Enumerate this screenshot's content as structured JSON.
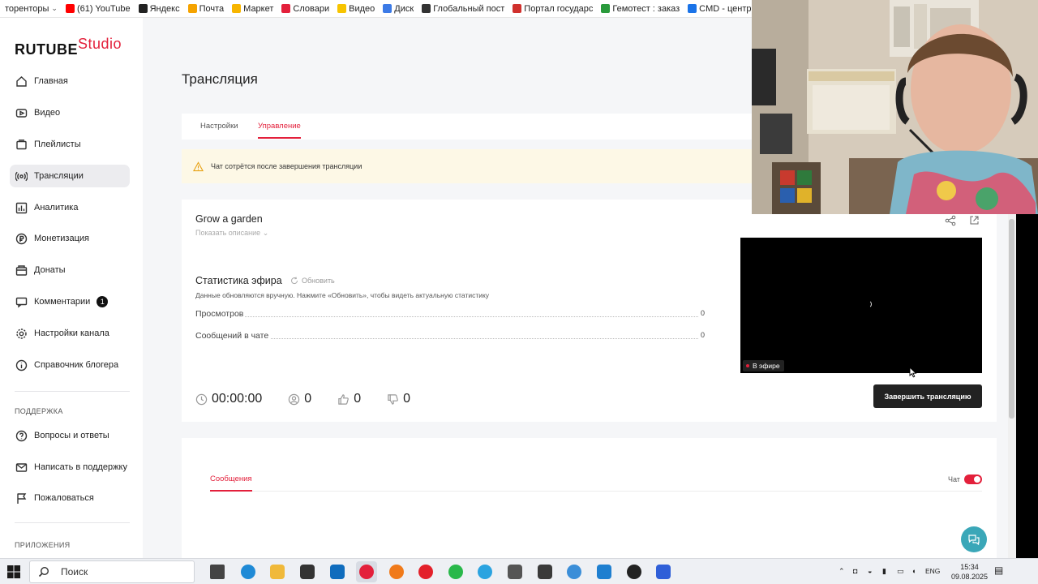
{
  "bookmarks": [
    {
      "label": "торенторы",
      "color": "#f2c200",
      "folder": true
    },
    {
      "label": "(61) YouTube",
      "color": "#ff0000"
    },
    {
      "label": "Яндекс",
      "color": "#222222"
    },
    {
      "label": "Почта",
      "color": "#f5a300"
    },
    {
      "label": "Маркет",
      "color": "#f7b500"
    },
    {
      "label": "Словари",
      "color": "#e3203b"
    },
    {
      "label": "Видео",
      "color": "#f7c400"
    },
    {
      "label": "Диск",
      "color": "#3c7ae6"
    },
    {
      "label": "Глобальный пост",
      "color": "#333333"
    },
    {
      "label": "Портал государс",
      "color": "#d0302d"
    },
    {
      "label": "Гемотест : заказ",
      "color": "#2a9a3c"
    },
    {
      "label": "CMD - центр мол",
      "color": "#1a73e8"
    }
  ],
  "logo": {
    "brand": "RUTUBE",
    "studio": "Studio"
  },
  "sidebar": {
    "items": [
      {
        "label": "Главная",
        "icon": "home-icon"
      },
      {
        "label": "Видео",
        "icon": "video-icon"
      },
      {
        "label": "Плейлисты",
        "icon": "playlist-icon"
      },
      {
        "label": "Трансляции",
        "icon": "broadcast-icon",
        "active": true
      },
      {
        "label": "Аналитика",
        "icon": "analytics-icon"
      },
      {
        "label": "Монетизация",
        "icon": "ruble-icon"
      },
      {
        "label": "Донаты",
        "icon": "donate-icon"
      },
      {
        "label": "Комментарии",
        "icon": "comment-icon",
        "badge": "1"
      },
      {
        "label": "Настройки канала",
        "icon": "gear-icon"
      },
      {
        "label": "Справочник блогера",
        "icon": "info-icon"
      }
    ],
    "support_heading": "ПОДДЕРЖКА",
    "support_items": [
      {
        "label": "Вопросы и ответы",
        "icon": "question-icon"
      },
      {
        "label": "Написать в поддержку",
        "icon": "mail-icon"
      },
      {
        "label": "Пожаловаться",
        "icon": "flag-icon"
      }
    ],
    "apps_heading": "ПРИЛОЖЕНИЯ"
  },
  "main": {
    "title": "Трансляция",
    "tabs": [
      {
        "label": "Настройки"
      },
      {
        "label": "Управление",
        "active": true
      }
    ],
    "warning": "Чат сотрётся после завершения трансляции",
    "stream": {
      "title": "Grow a garden",
      "show_description": "Показать описание",
      "stats_title": "Статистика эфира",
      "refresh_label": "Обновить",
      "stats_note": "Данные обновляются вручную. Нажмите «Обновить», чтобы видеть актуальную статистику",
      "stats": [
        {
          "label": "Просмотров",
          "value": "0"
        },
        {
          "label": "Сообщений в чате",
          "value": "0"
        }
      ],
      "duration": "00:00:00",
      "viewers": "0",
      "likes": "0",
      "dislikes": "0",
      "live_label": "В эфире",
      "end_button": "Завершить трансляцию"
    },
    "messages": {
      "tab": "Сообщения",
      "chat_label": "Чат",
      "chat_enabled": true
    }
  },
  "taskbar": {
    "search_placeholder": "Поиск",
    "language": "ENG",
    "time": "15:34",
    "date": "09.08.2025"
  },
  "colors": {
    "accent": "#e3203b",
    "warning_bg": "#fdf8e6",
    "support_fab": "#3aa7b8"
  }
}
